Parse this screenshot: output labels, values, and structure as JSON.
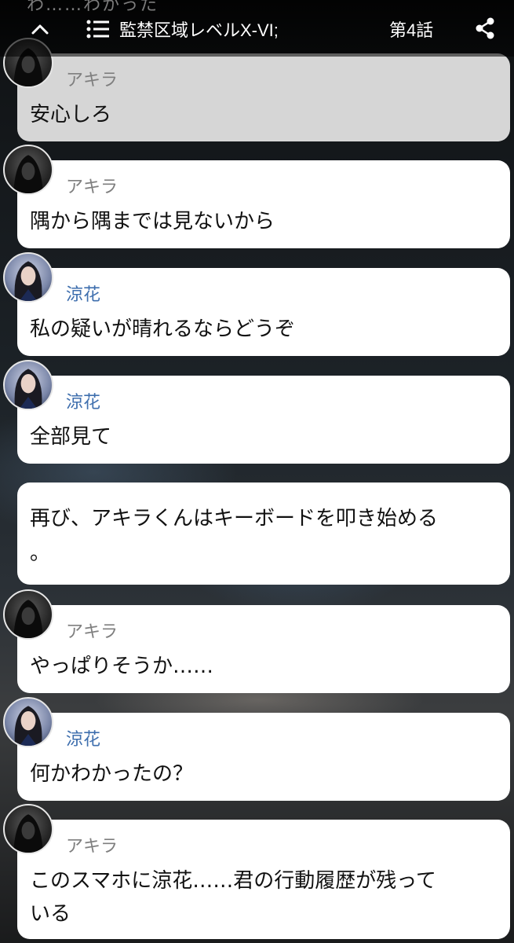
{
  "header": {
    "peek_text": "わ……わかった",
    "title": "監禁区域レベルX-VI;",
    "episode": "第4話"
  },
  "messages": [
    {
      "speaker": "アキラ",
      "text": [
        "安心しろ"
      ]
    },
    {
      "speaker": "アキラ",
      "text": [
        "隅から隅までは見ないから"
      ]
    },
    {
      "speaker": "涼花",
      "text": [
        "私の疑いが晴れるならどうぞ"
      ]
    },
    {
      "speaker": "涼花",
      "text": [
        "全部見て"
      ]
    },
    {
      "speaker": "",
      "text": [
        "再び、アキラくんはキーボードを叩き始める",
        "。"
      ]
    },
    {
      "speaker": "アキラ",
      "text": [
        "やっぱりそうか……"
      ]
    },
    {
      "speaker": "涼花",
      "text": [
        "何かわかったの？"
      ]
    },
    {
      "speaker": "アキラ",
      "text": [
        "このスマホに涼花……君の行動履歴が残って",
        "いる"
      ]
    }
  ],
  "colors": {
    "akira_name": "#7f7f7f",
    "suzuka_name": "#3f6fae",
    "bubble": "#ffffff",
    "bubble_dim": "#d6d6d6"
  },
  "icons": {
    "back": "chevron-up-icon",
    "menu": "list-menu-icon",
    "share": "share-icon"
  }
}
